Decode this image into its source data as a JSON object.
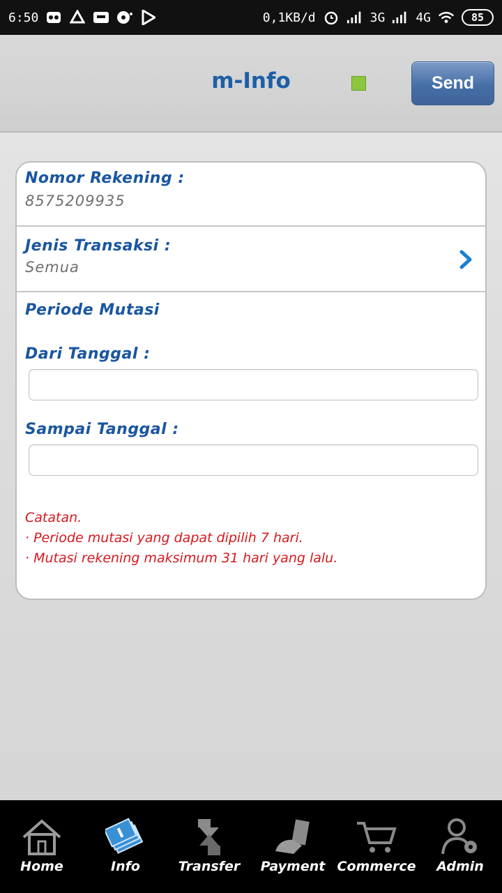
{
  "status_bar": {
    "time": "6:50",
    "network_speed": "0,1KB/d",
    "signal_1": "3G",
    "signal_2": "4G",
    "battery": "85"
  },
  "header": {
    "title": "m-Info",
    "send_label": "Send",
    "indicator_color": "#8cc63f"
  },
  "form": {
    "account_label": "Nomor Rekening :",
    "account_value": "8575209935",
    "transaction_type_label": "Jenis Transaksi :",
    "transaction_type_value": "Semua",
    "period_heading": "Periode Mutasi",
    "from_date_label": "Dari Tanggal :",
    "from_date_value": "",
    "to_date_label": "Sampai Tanggal :",
    "to_date_value": ""
  },
  "notes": {
    "title": "Catatan.",
    "lines": [
      "· Periode mutasi yang dapat dipilih 7 hari.",
      "· Mutasi rekening maksimum 31 hari yang lalu."
    ]
  },
  "bottom_nav": {
    "items": [
      {
        "label": "Home",
        "icon": "home-icon"
      },
      {
        "label": "Info",
        "icon": "info-icon"
      },
      {
        "label": "Transfer",
        "icon": "transfer-icon"
      },
      {
        "label": "Payment",
        "icon": "payment-icon"
      },
      {
        "label": "Commerce",
        "icon": "cart-icon"
      },
      {
        "label": "Admin",
        "icon": "admin-icon"
      }
    ]
  },
  "colors": {
    "accent": "#1a56a0",
    "note": "#d7181e",
    "send_button": "#466fa6"
  }
}
